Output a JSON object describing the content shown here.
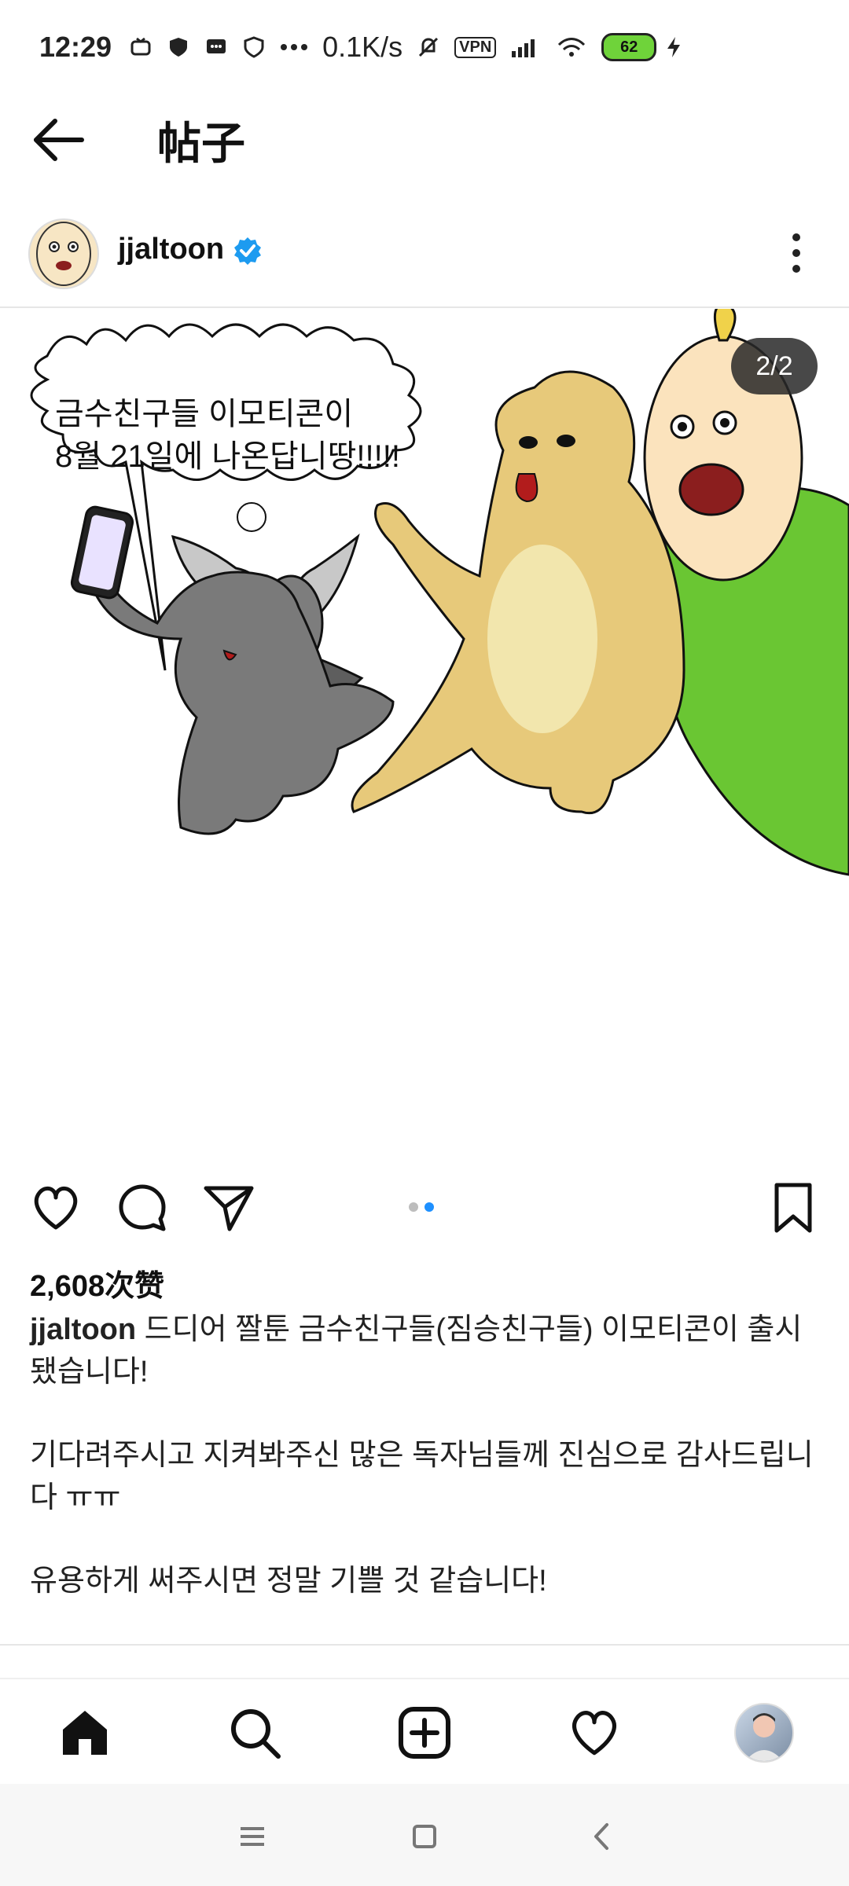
{
  "status_bar": {
    "time": "12:29",
    "speed": "0.1K/s",
    "vpn": "VPN",
    "battery": "62"
  },
  "app_bar": {
    "title": "帖子"
  },
  "post": {
    "username": "jjaltoon",
    "image_counter": "2/2",
    "bubble_line1": "금수친구들 이모티콘이",
    "bubble_line2": "8월 21일에 나온답니땅!!!!!",
    "likes": "2,608次赞",
    "caption_user": "jjaltoon",
    "caption_p1": "드디어 짤툰 금수친구들(짐승친구들) 이모티콘이 출시됐습니다!",
    "caption_p2": "기다려주시고 지켜봐주신 많은 독자님들께 진심으로 감사드립니다 ㅠㅠ",
    "caption_p3": "유용하게 써주시면 정말 기쁠 것 같습니다!"
  },
  "icons": {
    "back": "arrow-left-icon",
    "verified": "verified-badge-icon",
    "more": "more-vertical-icon",
    "like": "heart-icon",
    "comment": "comment-icon",
    "share": "send-icon",
    "save": "bookmark-icon",
    "home": "home-icon",
    "search": "search-icon",
    "create": "plus-square-icon",
    "activity": "heart-icon"
  },
  "colors": {
    "accent": "#1e90ff",
    "verified": "#1d9bf0",
    "green_character": "#6ac633",
    "dog": "#e7c97a",
    "cat": "#7a7a7a"
  }
}
